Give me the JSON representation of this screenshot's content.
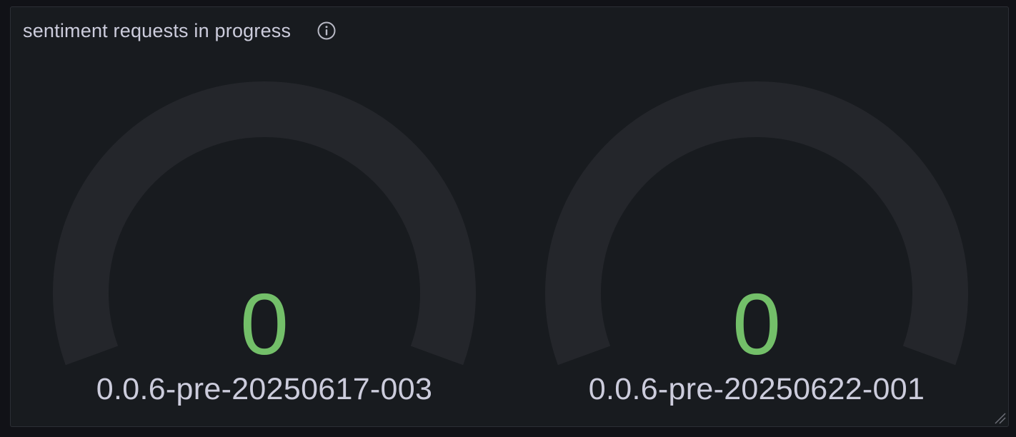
{
  "panel": {
    "title": "sentiment requests in progress",
    "info_icon": "info-circle-icon",
    "resize_icon": "resize-handle-icon"
  },
  "colors": {
    "panel_bg": "#181b1f",
    "track": "#24262b",
    "value": "#73bf69",
    "text": "#ccccdc"
  },
  "gauges": [
    {
      "value": "0",
      "label": "0.0.6-pre-20250617-003",
      "fraction": 0
    },
    {
      "value": "0",
      "label": "0.0.6-pre-20250622-001",
      "fraction": 0
    }
  ]
}
